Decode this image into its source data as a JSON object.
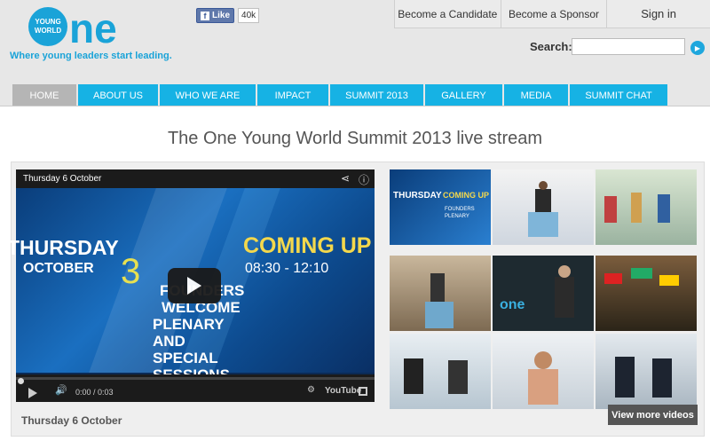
{
  "brand": {
    "logo_small": "YOUNG\nWORLD",
    "logo_big": "one",
    "tagline": "Where young leaders start leading."
  },
  "facebook": {
    "like_label": "Like",
    "count": "40k"
  },
  "topnav": {
    "candidate": "Become a Candidate",
    "sponsor": "Become a Sponsor",
    "signin": "Sign in"
  },
  "search": {
    "label": "Search:",
    "placeholder": ""
  },
  "mainnav": [
    {
      "label": "HOME",
      "active": true
    },
    {
      "label": "ABOUT US"
    },
    {
      "label": "WHO WE ARE"
    },
    {
      "label": "IMPACT"
    },
    {
      "label": "SUMMIT 2013"
    },
    {
      "label": "GALLERY"
    },
    {
      "label": "MEDIA"
    },
    {
      "label": "SUMMIT CHAT"
    }
  ],
  "page_title": "The One Young World Summit 2013 live stream",
  "video": {
    "title": "Thursday 6 October",
    "slide": {
      "thursday": "THURSDAY",
      "october": "OCTOBER",
      "day": "3",
      "coming_up": "COMING UP",
      "time": "08:30 - 12:10",
      "line1": "FOUNDERS",
      "line2": "WELCOME",
      "line3": "PLENARY",
      "line4": "AND",
      "line5": "SPECIAL",
      "line6": "SESSIONS"
    },
    "time": "0:00 / 0:03",
    "youtube": "YouTube"
  },
  "caption": "Thursday 6 October",
  "more_videos": "View more videos",
  "colors": {
    "accent": "#16b2e4",
    "nav_active": "#b5b5b5"
  }
}
